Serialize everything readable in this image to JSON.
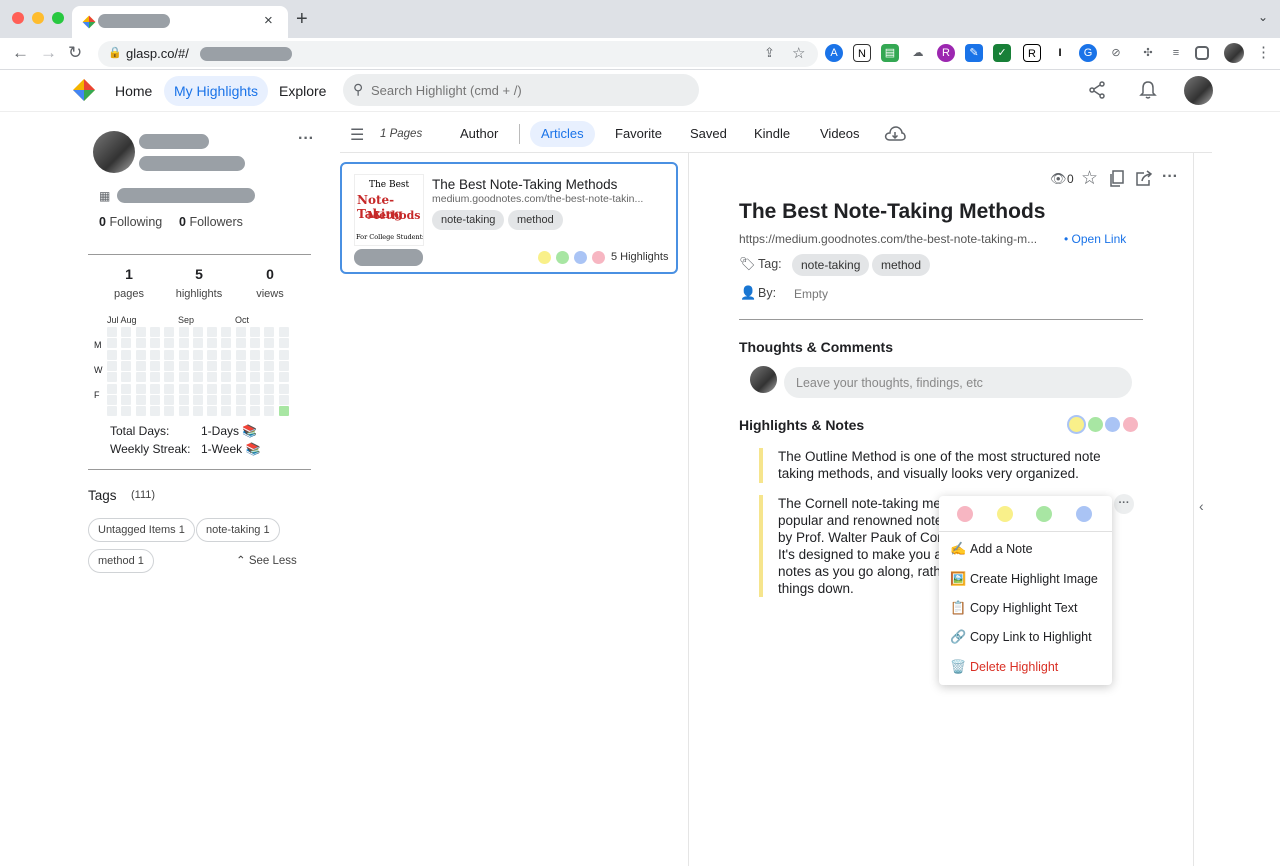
{
  "browser": {
    "url": "glasp.co/#/",
    "tab_close": "×",
    "new_tab": "+"
  },
  "header": {
    "nav": [
      "Home",
      "My Highlights",
      "Explore"
    ],
    "search_placeholder": "Search Highlight (cmd + /)"
  },
  "profile": {
    "following_count": "0",
    "following_label": "Following",
    "followers_count": "0",
    "followers_label": "Followers",
    "more": "···",
    "stats": [
      {
        "num": "1",
        "label": "pages"
      },
      {
        "num": "5",
        "label": "highlights"
      },
      {
        "num": "0",
        "label": "views"
      }
    ],
    "months": [
      "Jul Aug",
      "Sep",
      "Oct"
    ],
    "weekdays": [
      "M",
      "W",
      "F"
    ],
    "total_days_label": "Total Days:",
    "total_days_value": "1-Days 📚",
    "weekly_streak_label": "Weekly Streak:",
    "weekly_streak_value": "1-Week 📚"
  },
  "tags": {
    "title": "Tags",
    "count": "(111)",
    "items": [
      "Untagged Items 1",
      "note-taking 1",
      "method 1"
    ],
    "see_less": "See Less"
  },
  "filters": {
    "pages": "1 Pages",
    "tabs": [
      "Author",
      "Articles",
      "Favorite",
      "Saved",
      "Kindle",
      "Videos"
    ]
  },
  "card": {
    "title": "The Best Note-Taking Methods",
    "url": "medium.goodnotes.com/the-best-note-takin...",
    "tags": [
      "note-taking",
      "method"
    ],
    "highlights": "5 Highlights",
    "thumb_lines": [
      "The Best",
      "Note-Taking",
      "Methods",
      "For College Students"
    ]
  },
  "detail": {
    "views": "0",
    "title": "The Best Note-Taking Methods",
    "url": "https://medium.goodnotes.com/the-best-note-taking-m...",
    "open_link": "• Open Link",
    "tag_label": "Tag:",
    "tags": [
      "note-taking",
      "method"
    ],
    "by_label": "By:",
    "by_value": "Empty",
    "thoughts_title": "Thoughts & Comments",
    "thoughts_placeholder": "Leave your thoughts, findings, etc",
    "highlights_title": "Highlights & Notes",
    "highlight1": [
      "The Outline Method is one of the most structured note",
      "taking methods, and visually looks very organized."
    ],
    "highlight2": [
      "The Cornell note-taking met",
      "popular and renowned note",
      "by Prof. Walter Pauk of Cor",
      "It's designed to make you a",
      "notes as you go along, rathe",
      "things down."
    ],
    "more": "···"
  },
  "menu": {
    "items": [
      {
        "icon": "✍️",
        "label": "Add a Note"
      },
      {
        "icon": "🖼️",
        "label": "Create Highlight Image"
      },
      {
        "icon": "📋",
        "label": "Copy Highlight Text"
      },
      {
        "icon": "🔗",
        "label": "Copy Link to Highlight"
      },
      {
        "icon": "🗑️",
        "label": "Delete Highlight"
      }
    ]
  },
  "colors": {
    "accent": "#1a73e8",
    "yellow": "#f9f08a",
    "green": "#a8e6a3",
    "blue": "#aac4f5",
    "pink": "#f7b6c2",
    "delete": "#d93025"
  }
}
